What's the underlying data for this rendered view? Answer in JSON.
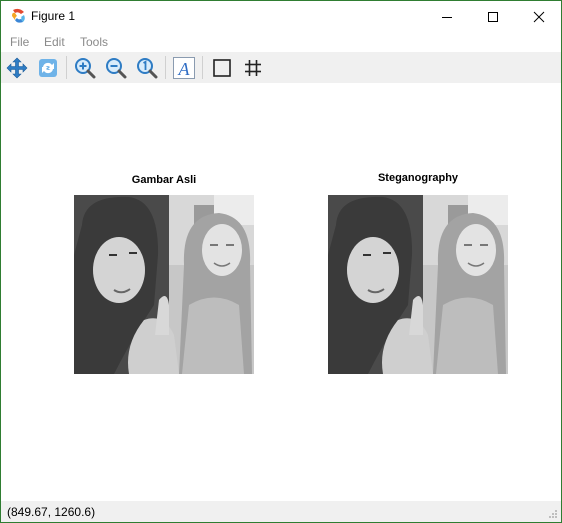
{
  "window": {
    "title": "Figure 1"
  },
  "menu": {
    "items": [
      "File",
      "Edit",
      "Tools"
    ]
  },
  "toolbar": {
    "tools": [
      "pan-icon",
      "rotate-icon",
      "zoom-in-icon",
      "zoom-out-icon",
      "zoom-fit-icon",
      "text-icon",
      "rectangle-icon",
      "grid-icon"
    ]
  },
  "figure": {
    "axes": [
      {
        "title": "Gambar Asli"
      },
      {
        "title": "Steganography"
      }
    ]
  },
  "status": {
    "coords": "(849.67, 1260.6)"
  },
  "colors": {
    "border": "#2f7d32",
    "toolbar": "#f0f0f0",
    "icon_blue": "#2e7cc4"
  }
}
